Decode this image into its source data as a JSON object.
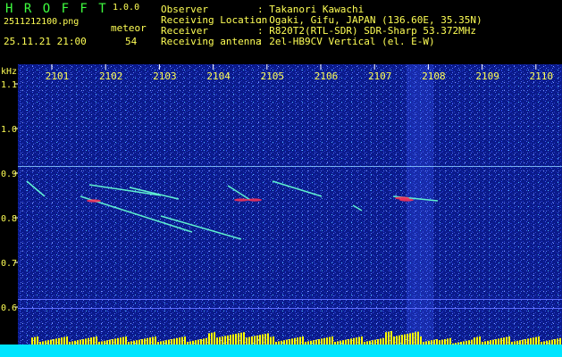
{
  "header": {
    "brand": "H R O F F T",
    "version": "1.0.0",
    "filename": "2511212100.png",
    "meteor_label": "meteor",
    "datetime": "25.11.21 21:00",
    "meteor_count": "54",
    "info": [
      {
        "label": "Observer",
        "value": ": Takanori Kawachi"
      },
      {
        "label": "Receiving Location",
        "value": ": Ogaki, Gifu, JAPAN (136.60E, 35.35N)"
      },
      {
        "label": "Receiver",
        "value": ": R820T2(RTL-SDR) SDR-Sharp 53.372MHz"
      },
      {
        "label": "Receiving antenna",
        "value": ": 2el-HB9CV Vertical (el. E-W)"
      }
    ]
  },
  "chart_data": {
    "type": "heatmap",
    "ylabel": "kHz",
    "y_ticks": [
      "1.1",
      "1.0",
      "0.9",
      "0.8",
      "0.7",
      "0.6"
    ],
    "x_ticks": [
      "2101",
      "2102",
      "2103",
      "2104",
      "2105",
      "2106",
      "2107",
      "2108",
      "2109",
      "2110"
    ],
    "baseline_khz": 0.915,
    "colors": {
      "background": "#0a1a8a",
      "grid": "#5a6aff",
      "trace": "#ff3355",
      "activity": "#ffff00",
      "floor": "#00e5ff"
    }
  }
}
